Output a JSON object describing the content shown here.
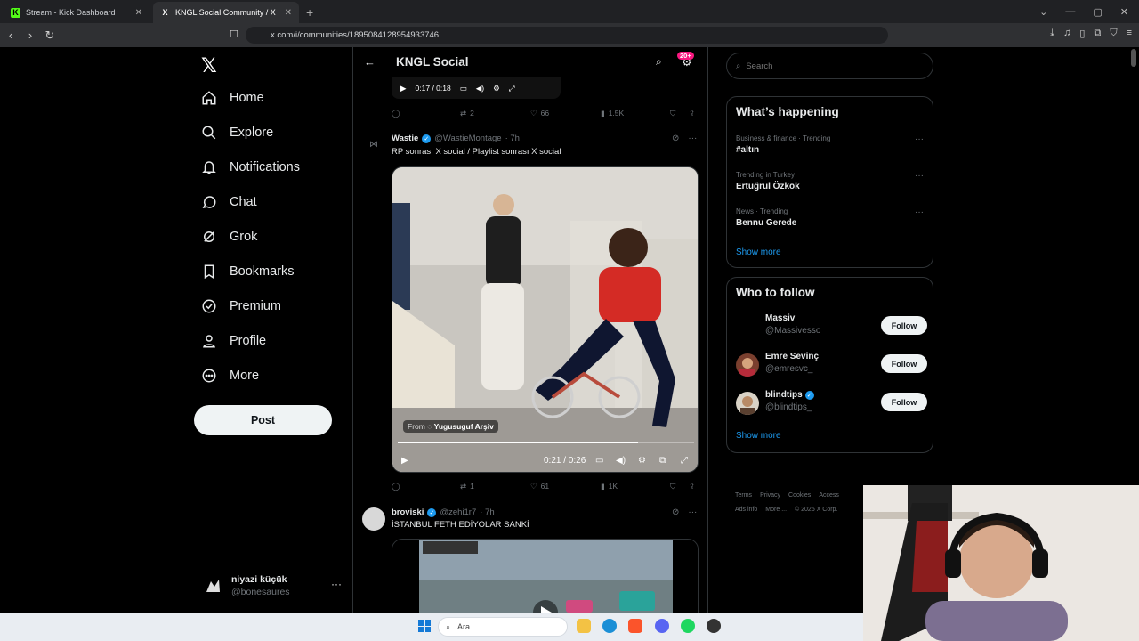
{
  "browser": {
    "tabs": [
      {
        "title": "Stream - Kick Dashboard",
        "favicon": "K"
      },
      {
        "title": "KNGL Social Community / X",
        "favicon": "X"
      }
    ],
    "url": "x.com/i/communities/1895084128954933746"
  },
  "nav": {
    "items": [
      {
        "label": "Home",
        "icon": "home-icon"
      },
      {
        "label": "Explore",
        "icon": "search-icon"
      },
      {
        "label": "Notifications",
        "icon": "bell-icon"
      },
      {
        "label": "Chat",
        "icon": "chat-icon"
      },
      {
        "label": "Grok",
        "icon": "grok-icon"
      },
      {
        "label": "Bookmarks",
        "icon": "bookmark-icon"
      },
      {
        "label": "Premium",
        "icon": "premium-icon"
      },
      {
        "label": "Profile",
        "icon": "profile-icon"
      },
      {
        "label": "More",
        "icon": "more-icon"
      }
    ],
    "post_label": "Post",
    "account": {
      "name": "niyazi küçük",
      "handle": "@bonesaures"
    }
  },
  "header": {
    "title": "KNGL Social",
    "badge": "20+"
  },
  "prev_post": {
    "player_time": "0:17 / 0:18",
    "replies": "",
    "reposts": "2",
    "likes": "66",
    "views": "1.5K"
  },
  "post1": {
    "name": "Wastie",
    "handle": "@WastieMontage",
    "time": "· 7h",
    "text": "RP sonrası X social / Playlist sonrası X social",
    "video": {
      "from_label": "From",
      "from_source": "Yugusuguf Arşiv",
      "time": "0:21 / 0:26",
      "progress": 0.81
    },
    "reposts": "1",
    "likes": "61",
    "views": "1K"
  },
  "post2": {
    "name": "broviski",
    "handle": "@zehi1r7",
    "time": "· 7h",
    "text": "İSTANBUL FETH EDİYOLAR SANKİ"
  },
  "right": {
    "search_placeholder": "Search",
    "happening_title": "What’s happening",
    "trends": [
      {
        "meta": "Business & finance · Trending",
        "title": "#altın"
      },
      {
        "meta": "Trending in Turkey",
        "title": "Ertuğrul Özkök"
      },
      {
        "meta": "News · Trending",
        "title": "Bennu Gerede"
      }
    ],
    "show_more": "Show more",
    "follow_title": "Who to follow",
    "follow": [
      {
        "name": "Massiv",
        "handle": "@Massivesso",
        "verified": false
      },
      {
        "name": "Emre Sevinç",
        "handle": "@emresvc_",
        "verified": false
      },
      {
        "name": "blindtips",
        "handle": "@blindtips_",
        "verified": true
      }
    ],
    "follow_label": "Follow",
    "footer": {
      "terms": "Terms",
      "privacy": "Privacy",
      "cookies": "Cookies",
      "access": "Access",
      "ads": "Ads info",
      "more": "More ...",
      "copyright": "© 2025 X Corp."
    }
  },
  "taskbar": {
    "search_placeholder": "Ara"
  },
  "colors": {
    "accent": "#1d9bf0",
    "badge": "#f91880",
    "bg": "#000000",
    "border": "#2f3336"
  }
}
